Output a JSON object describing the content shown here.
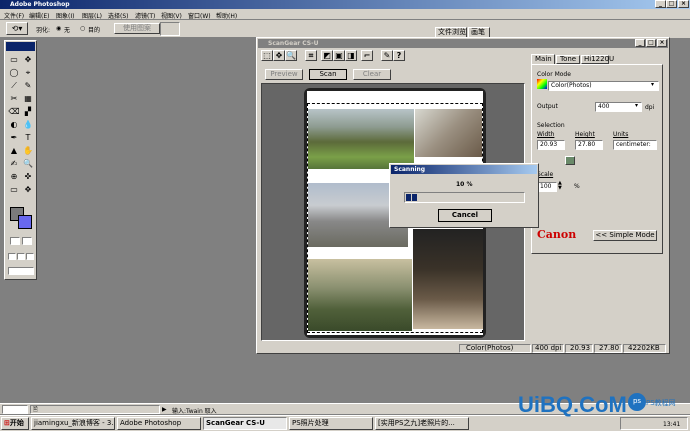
{
  "app": {
    "title": "Adobe Photoshop"
  },
  "menu": [
    "文件(F)",
    "编辑(E)",
    "图象(I)",
    "图层(L)",
    "选择(S)",
    "滤镜(T)",
    "视图(V)",
    "窗口(W)",
    "帮助(H)"
  ],
  "options": {
    "feather_label": "羽化:",
    "mode_a": "无",
    "mode_b": "目的",
    "use_pattern": "使用图案",
    "tabs": [
      "文件浏览",
      "画笔"
    ]
  },
  "scangear": {
    "title": "ScanGear CS-U",
    "buttons": {
      "preview": "Preview",
      "scan": "Scan",
      "clear": "Clear"
    },
    "tabs": [
      "Main",
      "Tone",
      "Hi1220U"
    ],
    "color_mode_label": "Color Mode",
    "color_mode_value": "Color(Photos)",
    "output_label": "Output",
    "output_value": "400",
    "output_unit": "dpi",
    "selection_label": "Selection",
    "width_label": "Width",
    "width_value": "20.93",
    "height_label": "Height",
    "height_value": "27.80",
    "units_label": "Units",
    "units_value": "centimeter:",
    "scale_label": "Scale",
    "scale_value": "100",
    "scale_unit": "%",
    "brand": "Canon",
    "simple_mode": "<< Simple Mode",
    "status": {
      "mode": "Color(Photos)",
      "dpi": "400 dpi",
      "w": "20.93",
      "h": "27.80",
      "size": "42202KB"
    }
  },
  "scanning": {
    "title": "Scanning",
    "percent": "10 %",
    "progress": 0.1,
    "cancel": "Cancel"
  },
  "ps_status": {
    "text": "输入:Twain 取入"
  },
  "taskbar": {
    "start": "开始",
    "items": [
      "jiamingxu_新浪博客 - 3...",
      "Adobe Photoshop",
      "ScanGear CS-U",
      "PS照片处理",
      "[实用PS之九]老照片的..."
    ],
    "time": "13:41"
  },
  "watermark": {
    "site": "UiBQ.CoM",
    "sub": "PS教程网",
    "tag": "ps"
  }
}
